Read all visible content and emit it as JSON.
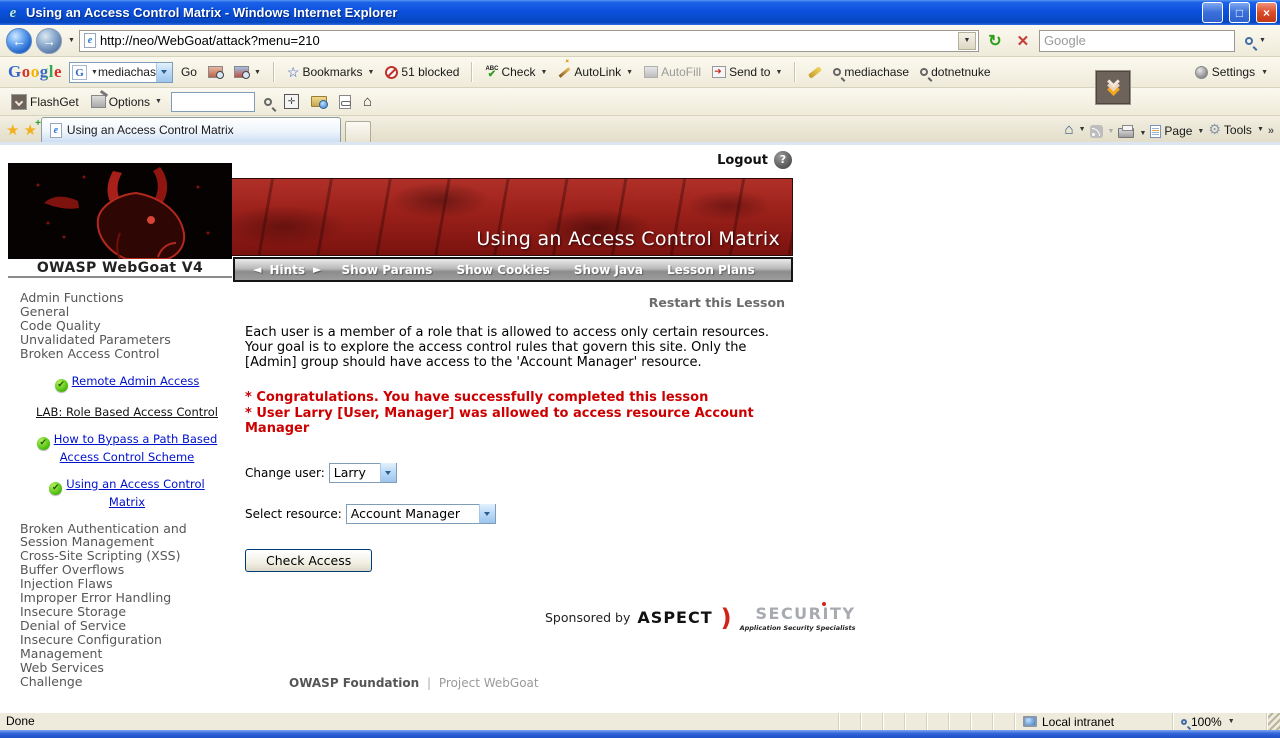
{
  "window": {
    "title": "Using an Access Control Matrix - Windows Internet Explorer"
  },
  "address_bar": {
    "url": "http://neo/WebGoat/attack?menu=210",
    "search_placeholder": "Google"
  },
  "google_toolbar": {
    "logo": "Google",
    "search_value": "mediachase",
    "go": "Go",
    "bookmarks": "Bookmarks",
    "blocked": "51 blocked",
    "check": "Check",
    "autolink": "AutoLink",
    "autofill": "AutoFill",
    "send_to": "Send to",
    "mediachase": "mediachase",
    "dotnetnuke": "dotnetnuke",
    "settings": "Settings"
  },
  "flashget_toolbar": {
    "flashget": "FlashGet",
    "options": "Options"
  },
  "tab_bar": {
    "active_tab": "Using an Access Control Matrix",
    "page": "Page",
    "tools": "Tools"
  },
  "webgoat": {
    "logout": "Logout",
    "help": "?",
    "brand": "OWASP WebGoat V4",
    "lesson_title": "Using an Access Control Matrix",
    "menu": [
      "Hints",
      "Show Params",
      "Show Cookies",
      "Show Java",
      "Lesson Plans"
    ],
    "restart": "Restart this Lesson",
    "description": "Each user is a member of a role that is allowed to access only certain resources. Your goal is to explore the access control rules that govern this site. Only the [Admin] group should have access to the 'Account Manager' resource.",
    "messages": [
      "* Congratulations. You have successfully completed this lesson",
      "* User Larry [User, Manager] was allowed to access resource Account Manager"
    ],
    "form": {
      "change_user_label": "Change user:",
      "change_user_value": "Larry",
      "select_resource_label": "Select resource:",
      "select_resource_value": "Account Manager",
      "check_access": "Check Access"
    },
    "sponsor": {
      "prefix": "Sponsored by",
      "name_black": "ASPECT",
      "name_gray": "SECURITY",
      "tagline": "Application Security Specialists"
    },
    "footer": {
      "owasp": "OWASP Foundation",
      "sep": "|",
      "project": "Project WebGoat"
    }
  },
  "sidebar": {
    "categories_top": [
      "Admin Functions",
      "General",
      "Code Quality",
      "Unvalidated Parameters",
      "Broken Access Control"
    ],
    "lessons": [
      {
        "label": "Remote Admin Access",
        "completed": true
      },
      {
        "label": "LAB: Role Based Access Control",
        "completed": false
      },
      {
        "label": "How to Bypass a Path Based Access Control Scheme",
        "completed": true
      },
      {
        "label": "Using an Access Control Matrix",
        "completed": true
      }
    ],
    "categories_bottom": [
      "Broken Authentication and Session Management",
      "Cross-Site Scripting (XSS)",
      "Buffer Overflows",
      "Injection Flaws",
      "Improper Error Handling",
      "Insecure Storage",
      "Denial of Service",
      "Insecure Configuration Management",
      "Web Services",
      "Challenge"
    ]
  },
  "status_bar": {
    "status": "Done",
    "zone": "Local intranet",
    "zoom_level": "100%"
  },
  "colors": {
    "titlebar_blue": "#0B51DE",
    "banner_red": "#8F1B15",
    "link_blue": "#0011CC",
    "message_red": "#CC0000",
    "toolbar_beige": "#EFEBDA"
  }
}
